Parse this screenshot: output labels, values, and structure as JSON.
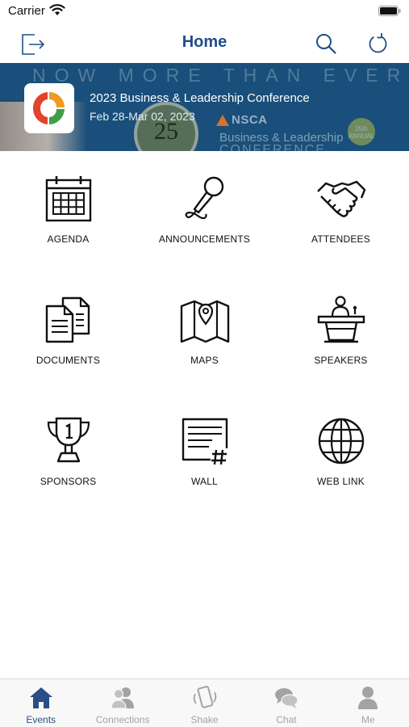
{
  "status_bar": {
    "carrier": "Carrier"
  },
  "nav": {
    "title": "Home"
  },
  "banner": {
    "bg_text": "NOW MORE THAN EVER",
    "event_title": "2023 Business & Leadership Conference",
    "event_dates": "Feb 28-Mar 02, 2023",
    "seal_text": "25",
    "brand": "NSCA",
    "bg_line1": "Business & Leadership",
    "bg_line2": "CONFERENCE",
    "anniv": "25th ANNUAL"
  },
  "tiles": [
    {
      "label": "AGENDA",
      "icon": "calendar-icon"
    },
    {
      "label": "ANNOUNCEMENTS",
      "icon": "microphone-icon"
    },
    {
      "label": "ATTENDEES",
      "icon": "handshake-icon"
    },
    {
      "label": "DOCUMENTS",
      "icon": "documents-icon"
    },
    {
      "label": "MAPS",
      "icon": "map-icon"
    },
    {
      "label": "SPEAKERS",
      "icon": "speaker-podium-icon"
    },
    {
      "label": "SPONSORS",
      "icon": "trophy-icon"
    },
    {
      "label": "WALL",
      "icon": "wall-post-icon"
    },
    {
      "label": "WEB LINK",
      "icon": "globe-icon"
    }
  ],
  "tabs": [
    {
      "label": "Events",
      "icon": "house-icon",
      "active": true
    },
    {
      "label": "Connections",
      "icon": "people-icon",
      "active": false
    },
    {
      "label": "Shake",
      "icon": "shake-phone-icon",
      "active": false
    },
    {
      "label": "Chat",
      "icon": "chat-bubbles-icon",
      "active": false
    },
    {
      "label": "Me",
      "icon": "person-icon",
      "active": false
    }
  ],
  "colors": {
    "accent": "#1f4e89",
    "banner": "#194f7a",
    "tab_active": "#2a4f86",
    "tab_inactive": "#a3a3a3"
  }
}
